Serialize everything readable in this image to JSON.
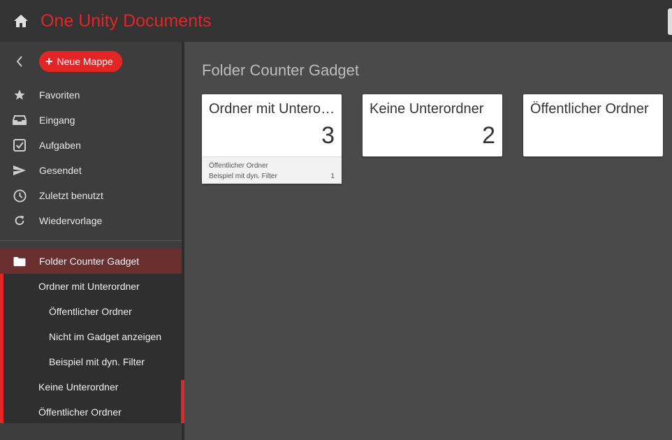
{
  "header": {
    "title": "One Unity Documents",
    "home_icon": "home-icon"
  },
  "sidebar": {
    "new_button": "Neue Mappe",
    "nav": [
      {
        "label": "Favoriten",
        "icon": "star-icon"
      },
      {
        "label": "Eingang",
        "icon": "inbox-icon"
      },
      {
        "label": "Aufgaben",
        "icon": "checkbox-icon"
      },
      {
        "label": "Gesendet",
        "icon": "send-icon"
      },
      {
        "label": "Zuletzt benutzt",
        "icon": "clock-icon"
      },
      {
        "label": "Wiedervorlage",
        "icon": "refresh-icon"
      }
    ],
    "tree": [
      {
        "label": "Folder Counter Gadget",
        "icon": "folder-icon",
        "active": true
      },
      {
        "label": "Ordner mit Unterordner"
      },
      {
        "label": "Öffentlicher Ordner"
      },
      {
        "label": "Nicht im Gadget anzeigen"
      },
      {
        "label": "Beispiel mit dyn. Filter"
      },
      {
        "label": "Keine Unterordner"
      },
      {
        "label": "Öffentlicher Ordner"
      }
    ]
  },
  "main": {
    "title": "Folder Counter Gadget",
    "cards": [
      {
        "title": "Ordner mit Unterordner",
        "count": "3",
        "subfolders": [
          {
            "name": "Öffentlicher Ordner",
            "count": ""
          },
          {
            "name": "Beispiel mit dyn. Filter",
            "count": "1"
          }
        ]
      },
      {
        "title": "Keine Unterordner",
        "count": "2"
      },
      {
        "title": "Öffentlicher Ordner",
        "count": ""
      }
    ]
  },
  "colors": {
    "accent": "#e32526",
    "header_bg": "#333333",
    "sidebar_bg": "#3d3d3d",
    "content_bg": "#4a4a4a"
  }
}
